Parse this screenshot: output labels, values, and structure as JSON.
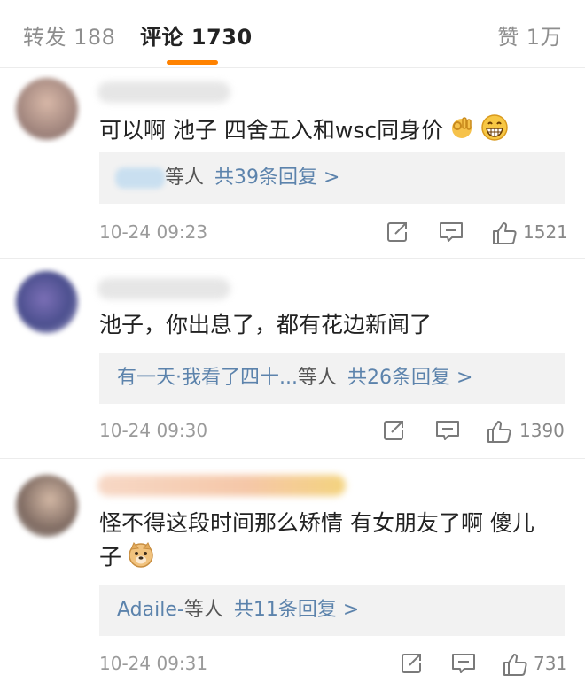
{
  "tabs": {
    "reposts": "转发 188",
    "comments": "评论 1730",
    "likes": "赞 1万"
  },
  "comments": [
    {
      "text": "可以啊 池子 四舍五入和wsc同身价",
      "reply_names": "",
      "reply_etc": "等人",
      "reply_count": "共39条回复 >",
      "time": "10-24 09:23",
      "likes": "1521"
    },
    {
      "text": "池子，你出息了，都有花边新闻了",
      "reply_names": "有一天·我看了四十...",
      "reply_etc": "等人",
      "reply_count": "共26条回复 >",
      "time": "10-24 09:30",
      "likes": "1390"
    },
    {
      "text_line1": "怪不得这段时间那么矫情 有女朋友了啊 傻儿",
      "text_line2": "子",
      "reply_names": "Adaile-",
      "reply_etc": "等人",
      "reply_count": "共11条回复 >",
      "time": "10-24 09:31",
      "likes": "731"
    }
  ],
  "icons": {
    "ok_hand": "ok-hand-emoji",
    "grin": "grin-emoji",
    "doge": "doge-emoji",
    "share": "share-icon",
    "comment": "comment-icon",
    "like": "like-icon"
  },
  "colors": {
    "accent": "#ff8200",
    "link": "#5c83ac",
    "text": "#222222",
    "muted": "#9a9a9a"
  }
}
